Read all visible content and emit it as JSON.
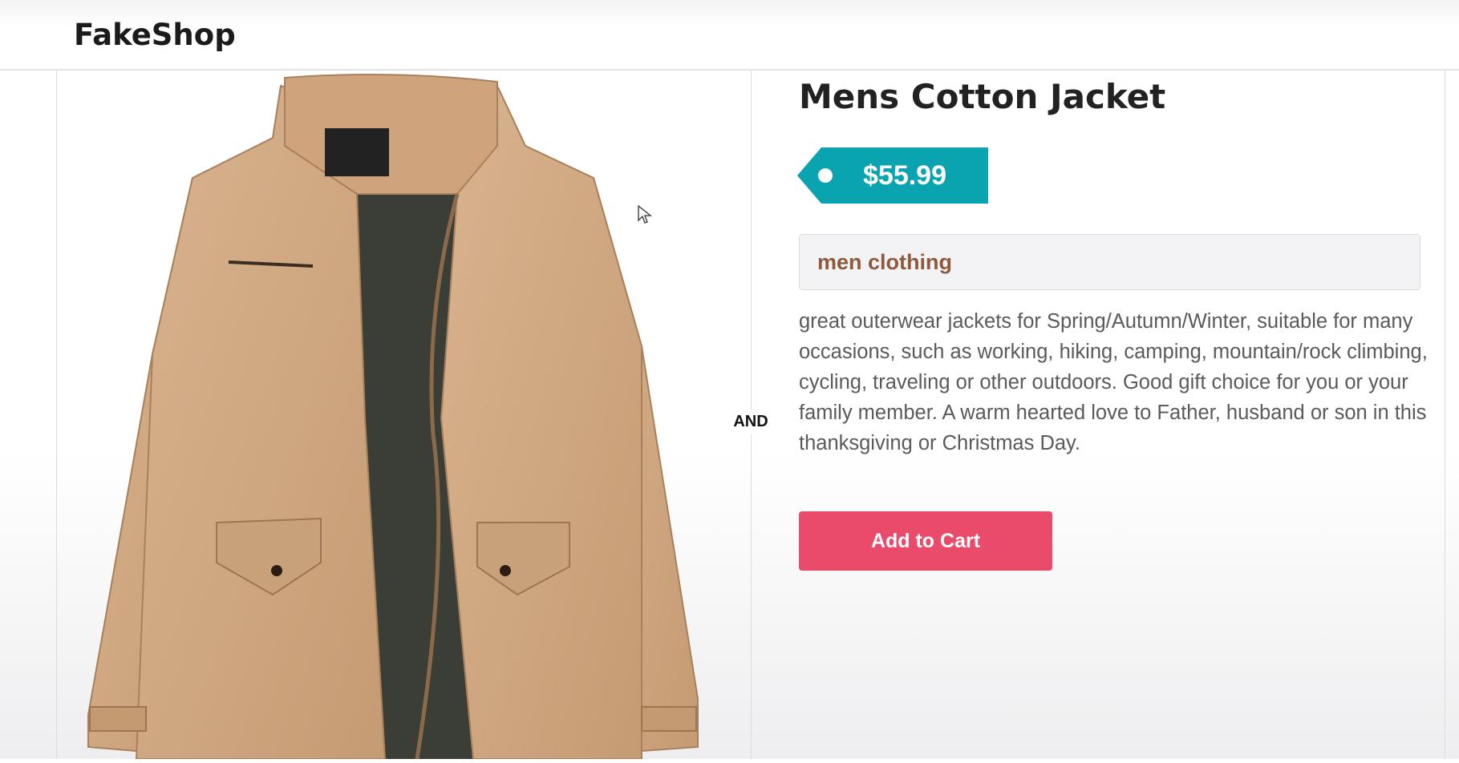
{
  "header": {
    "brand": "FakeShop"
  },
  "product": {
    "title": "Mens Cotton Jacket",
    "price": "$55.99",
    "category": "men clothing",
    "description": "great outerwear jackets for Spring/Autumn/Winter, suitable for many occasions, such as working, hiking, camping, mountain/rock climbing, cycling, traveling or other outdoors. Good gift choice for you or your family member. A warm hearted love to Father, husband or son in this thanksgiving or Christmas Day.",
    "add_to_cart_label": "Add to Cart",
    "image_icon": "jacket-image"
  },
  "separator": {
    "label": "AND"
  },
  "colors": {
    "price_tag": "#0aa4b1",
    "cart_button": "#ea4b6a",
    "category_text": "#8f5a3c"
  }
}
